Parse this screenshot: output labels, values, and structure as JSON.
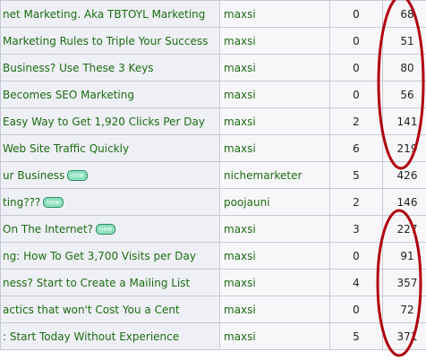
{
  "threads": [
    {
      "title": "net Marketing. Aka TBTOYL Marketing",
      "new": false,
      "author": "maxsi",
      "replies": "0",
      "views": "68"
    },
    {
      "title": "Marketing Rules to Triple Your Success",
      "new": false,
      "author": "maxsi",
      "replies": "0",
      "views": "51"
    },
    {
      "title": " Business? Use These 3 Keys",
      "new": false,
      "author": "maxsi",
      "replies": "0",
      "views": "80"
    },
    {
      "title": " Becomes SEO Marketing",
      "new": false,
      "author": "maxsi",
      "replies": "0",
      "views": "56"
    },
    {
      "title": " Easy Way to Get 1,920 Clicks Per Day",
      "new": false,
      "author": "maxsi",
      "replies": "2",
      "views": "141"
    },
    {
      "title": " Web Site Traffic Quickly",
      "new": false,
      "author": "maxsi",
      "replies": "6",
      "views": "219"
    },
    {
      "title": "ur Business",
      "new": true,
      "author": "nichemarketer",
      "replies": "5",
      "views": "426"
    },
    {
      "title": "ting???",
      "new": true,
      "author": "poojauni",
      "replies": "2",
      "views": "146"
    },
    {
      "title": " On The Internet?",
      "new": true,
      "author": "maxsi",
      "replies": "3",
      "views": "227"
    },
    {
      "title": "ng: How To Get 3,700 Visits per Day",
      "new": false,
      "author": "maxsi",
      "replies": "0",
      "views": "91"
    },
    {
      "title": "ness? Start to Create a Mailing List",
      "new": false,
      "author": "maxsi",
      "replies": "4",
      "views": "357"
    },
    {
      "title": "actics that won't Cost You a Cent",
      "new": false,
      "author": "maxsi",
      "replies": "0",
      "views": "72"
    },
    {
      "title": ": Start Today Without Experience",
      "new": false,
      "author": "maxsi",
      "replies": "5",
      "views": "371"
    }
  ],
  "new_badge_label": "new",
  "annotation_color": "#b00010"
}
